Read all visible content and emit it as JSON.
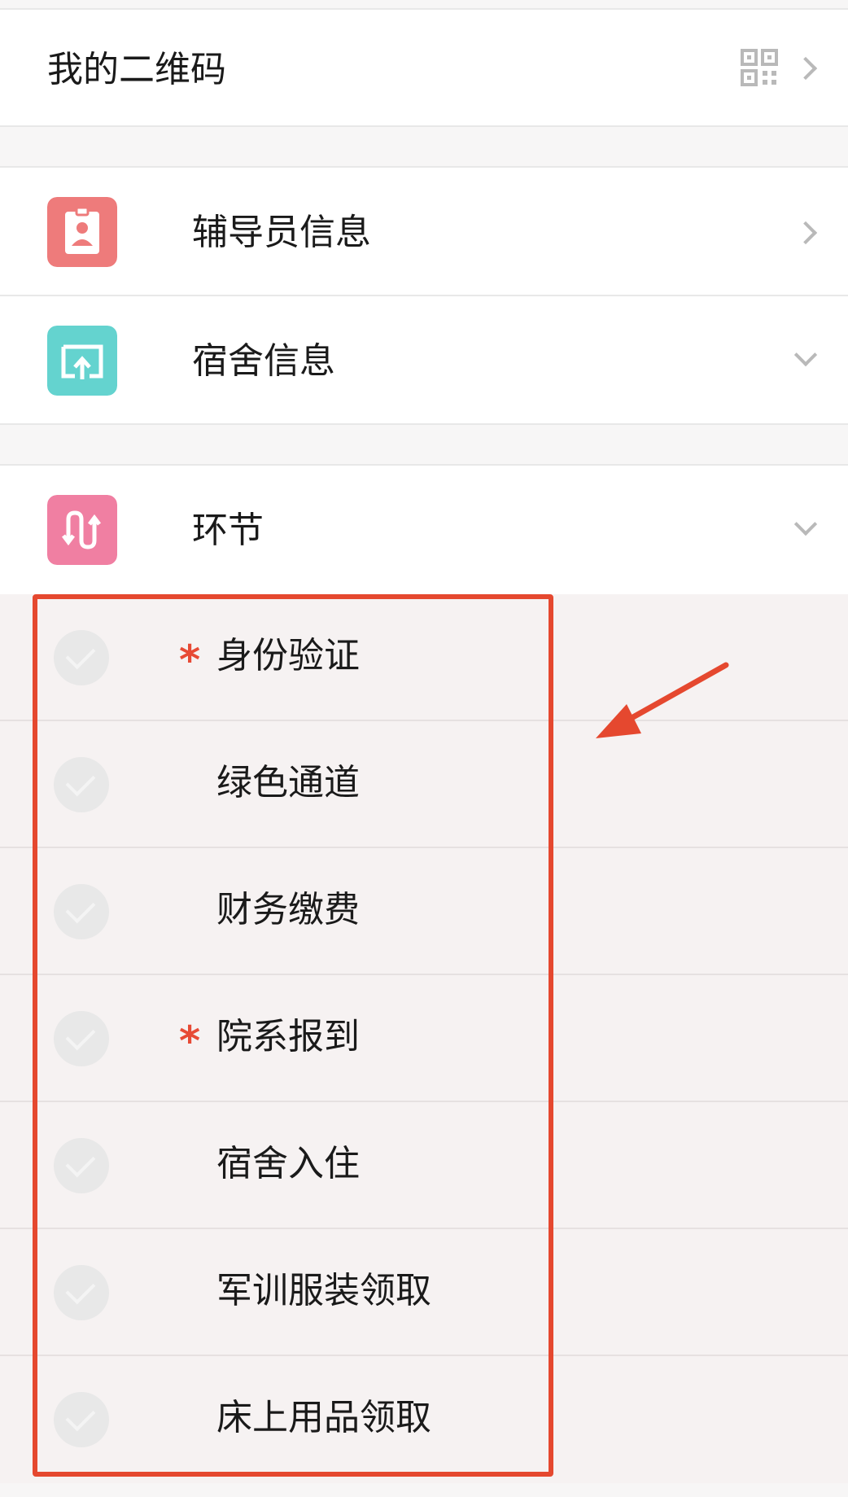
{
  "qr_row": {
    "label": "我的二维码",
    "icon": "qr-code-icon"
  },
  "counselor_row": {
    "label": "辅导员信息",
    "icon": "id-badge-icon",
    "color": "#ee7b7b"
  },
  "dorm_row": {
    "label": "宿舍信息",
    "icon": "upload-box-icon",
    "color": "#64d3cf"
  },
  "stage_row": {
    "label": "环节",
    "icon": "switch-arrows-icon",
    "color": "#f07fa2"
  },
  "steps": [
    {
      "label": "身份验证",
      "required": true,
      "marker": "*"
    },
    {
      "label": "绿色通道",
      "required": false
    },
    {
      "label": "财务缴费",
      "required": false
    },
    {
      "label": "院系报到",
      "required": true,
      "marker": "*"
    },
    {
      "label": "宿舍入住",
      "required": false
    },
    {
      "label": "军训服装领取",
      "required": false
    },
    {
      "label": "床上用品领取",
      "required": false
    }
  ],
  "annotation": {
    "box_color": "#e5482f"
  }
}
